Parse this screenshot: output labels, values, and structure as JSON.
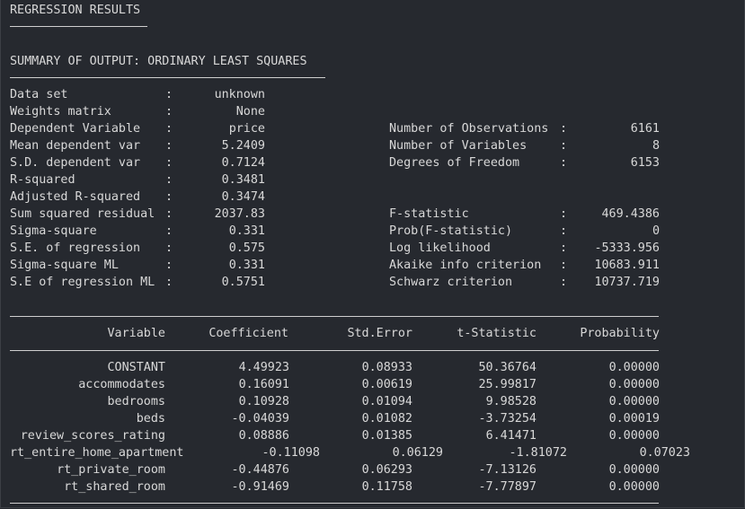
{
  "header": {
    "title": "REGRESSION RESULTS",
    "subtitle": "SUMMARY OF OUTPUT: ORDINARY LEAST SQUARES"
  },
  "left_stats": [
    {
      "label": "Data set",
      "sep": ":",
      "value": "unknown"
    },
    {
      "label": "Weights matrix",
      "sep": ":",
      "value": "None"
    },
    {
      "label": "Dependent Variable",
      "sep": ":",
      "value": "price"
    },
    {
      "label": "Mean dependent var",
      "sep": ":",
      "value": "5.2409"
    },
    {
      "label": "S.D. dependent var",
      "sep": ":",
      "value": "0.7124"
    },
    {
      "label": "R-squared",
      "sep": ":",
      "value": "0.3481"
    },
    {
      "label": "Adjusted R-squared",
      "sep": ":",
      "value": "0.3474"
    },
    {
      "label": "Sum squared residual",
      "sep": ":",
      "value": "2037.83"
    },
    {
      "label": "Sigma-square",
      "sep": ":",
      "value": "0.331"
    },
    {
      "label": "S.E. of regression",
      "sep": ":",
      "value": "0.575"
    },
    {
      "label": "Sigma-square ML",
      "sep": ":",
      "value": "0.331"
    },
    {
      "label": "S.E of regression ML",
      "sep": ":",
      "value": "0.5751"
    }
  ],
  "right_stats": [
    {
      "label": "Number of Observations",
      "sep": ":",
      "value": "6161"
    },
    {
      "label": "Number of Variables",
      "sep": ":",
      "value": "8"
    },
    {
      "label": "Degrees of Freedom",
      "sep": ":",
      "value": "6153"
    },
    {
      "label": "F-statistic",
      "sep": ":",
      "value": "469.4386"
    },
    {
      "label": "Prob(F-statistic)",
      "sep": ":",
      "value": "0"
    },
    {
      "label": "Log likelihood",
      "sep": ":",
      "value": "-5333.956"
    },
    {
      "label": "Akaike info criterion",
      "sep": ":",
      "value": "10683.911"
    },
    {
      "label": "Schwarz criterion",
      "sep": ":",
      "value": "10737.719"
    }
  ],
  "table": {
    "headers": [
      "Variable",
      "Coefficient",
      "Std.Error",
      "t-Statistic",
      "Probability"
    ],
    "rows": [
      [
        "CONSTANT",
        "4.49923",
        "0.08933",
        "50.36764",
        "0.00000"
      ],
      [
        "accommodates",
        "0.16091",
        "0.00619",
        "25.99817",
        "0.00000"
      ],
      [
        "bedrooms",
        "0.10928",
        "0.01094",
        "9.98528",
        "0.00000"
      ],
      [
        "beds",
        "-0.04039",
        "0.01082",
        "-3.73254",
        "0.00019"
      ],
      [
        "review_scores_rating",
        "0.08886",
        "0.01385",
        "6.41471",
        "0.00000"
      ],
      [
        "rt_entire_home_apartment",
        "-0.11098",
        "0.06129",
        "-1.81072",
        "0.07023"
      ],
      [
        "rt_private_room",
        "-0.44876",
        "0.06293",
        "-7.13126",
        "0.00000"
      ],
      [
        "rt_shared_room",
        "-0.91469",
        "0.11758",
        "-7.77897",
        "0.00000"
      ]
    ]
  }
}
